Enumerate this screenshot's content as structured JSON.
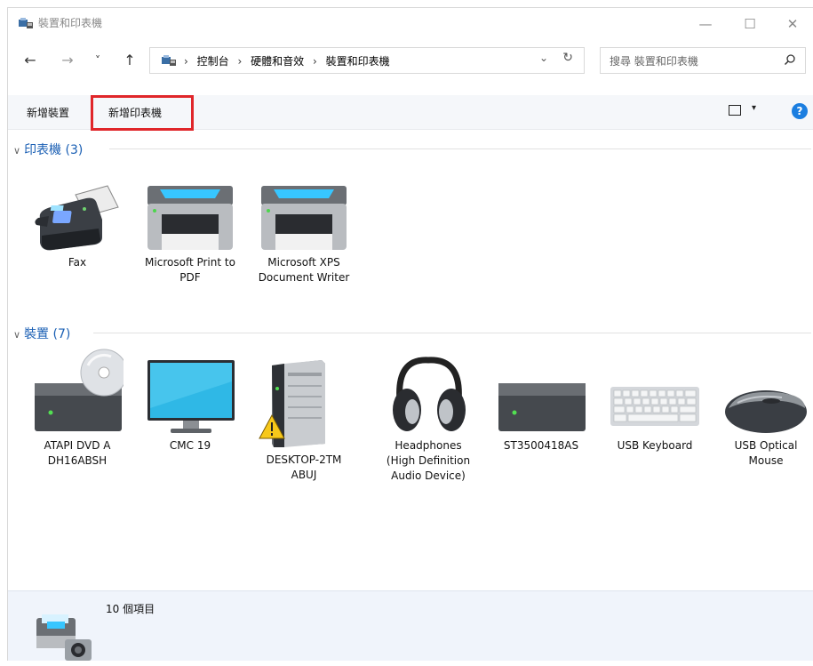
{
  "window": {
    "title": "裝置和印表機",
    "controls": {
      "minimize": "—",
      "maximize": "☐",
      "close": "✕"
    }
  },
  "nav": {
    "back": "←",
    "forward": "→",
    "recent": "˅",
    "up": "↑",
    "breadcrumbs": [
      "控制台",
      "硬體和音效",
      "裝置和印表機"
    ],
    "separator": "›",
    "dropdown": "⌄",
    "refresh": "↻",
    "search_placeholder": "搜尋 裝置和印表機"
  },
  "toolbar": {
    "add_device": "新增裝置",
    "add_printer": "新增印表機",
    "view_dropdown": "▾",
    "help": "?"
  },
  "groups": {
    "printers": {
      "label": "印表機 (3)",
      "items": [
        {
          "label": "Fax",
          "icon": "fax-icon"
        },
        {
          "label": "Microsoft Print to PDF",
          "icon": "printer-icon"
        },
        {
          "label": "Microsoft XPS Document Writer",
          "icon": "printer-icon"
        }
      ]
    },
    "devices": {
      "label": "裝置 (7)",
      "items": [
        {
          "label": "ATAPI DVD A DH16ABSH",
          "icon": "dvd-drive-icon"
        },
        {
          "label": "CMC 19",
          "icon": "monitor-icon"
        },
        {
          "label": "DESKTOP-2TM ABUJ",
          "icon": "computer-tower-icon"
        },
        {
          "label": "Headphones (High Definition Audio Device)",
          "icon": "headphones-icon"
        },
        {
          "label": "ST3500418AS",
          "icon": "hard-drive-icon"
        },
        {
          "label": "USB Keyboard",
          "icon": "keyboard-icon"
        },
        {
          "label": "USB Optical Mouse",
          "icon": "mouse-icon"
        }
      ]
    }
  },
  "status": {
    "count": "10 個項目"
  },
  "colors": {
    "accent": "#1a5fb4",
    "highlight": "#e0262a",
    "help": "#1b7ee0"
  }
}
